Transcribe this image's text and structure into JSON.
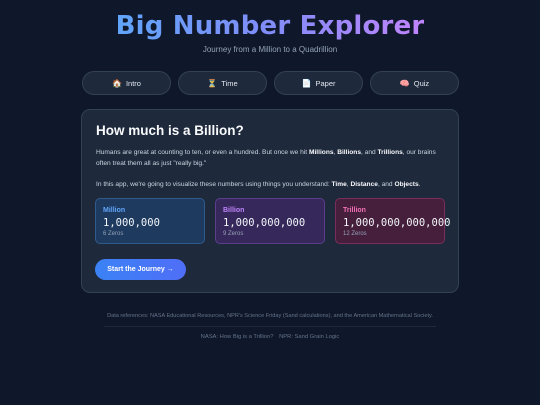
{
  "header": {
    "title": "Big Number Explorer",
    "subtitle": "Journey from a Million to a Quadrillion"
  },
  "nav": [
    {
      "icon": "house-icon",
      "glyph": "🏠",
      "label": "Intro"
    },
    {
      "icon": "hourglass-icon",
      "glyph": "⏳",
      "label": "Time"
    },
    {
      "icon": "page-icon",
      "glyph": "📄",
      "label": "Paper"
    },
    {
      "icon": "brain-icon",
      "glyph": "🧠",
      "label": "Quiz"
    }
  ],
  "card": {
    "title": "How much is a Billion?",
    "p1_a": "Humans are great at counting to ten, or even a hundred. But once we hit ",
    "p1_million": "Millions",
    "p1_sep1": ", ",
    "p1_billion": "Billions",
    "p1_sep2": ", and ",
    "p1_trillion": "Trillions",
    "p1_b": ", our brains often treat them all as just \"really big.\"",
    "p2_a": "In this app, we're going to visualize these numbers using things you understand: ",
    "p2_time": "Time",
    "p2_sep1": ", ",
    "p2_distance": "Distance",
    "p2_sep2": ", and ",
    "p2_objects": "Objects",
    "p2_end": ".",
    "boxes": [
      {
        "name": "Million",
        "number": "1,000,000",
        "zeros": "6 Zeros",
        "color": "#60a5fa"
      },
      {
        "name": "Billion",
        "number": "1,000,000,000",
        "zeros": "9 Zeros",
        "color": "#c084fc"
      },
      {
        "name": "Trillion",
        "number": "1,000,000,000,000",
        "zeros": "12 Zeros",
        "color": "#f472b6"
      }
    ],
    "start_label": "Start the Journey →"
  },
  "footer": {
    "refs": "Data references: NASA Educational Resources, NPR's Science Friday (Sand calculations), and the American Mathematical Society.",
    "link1": "NASA: How Big is a Trillion?",
    "link2": "NPR: Sand Grain Logic"
  },
  "colors": {
    "background": "#0f172a",
    "card": "#1e293b",
    "accent": "#3b82f6"
  }
}
